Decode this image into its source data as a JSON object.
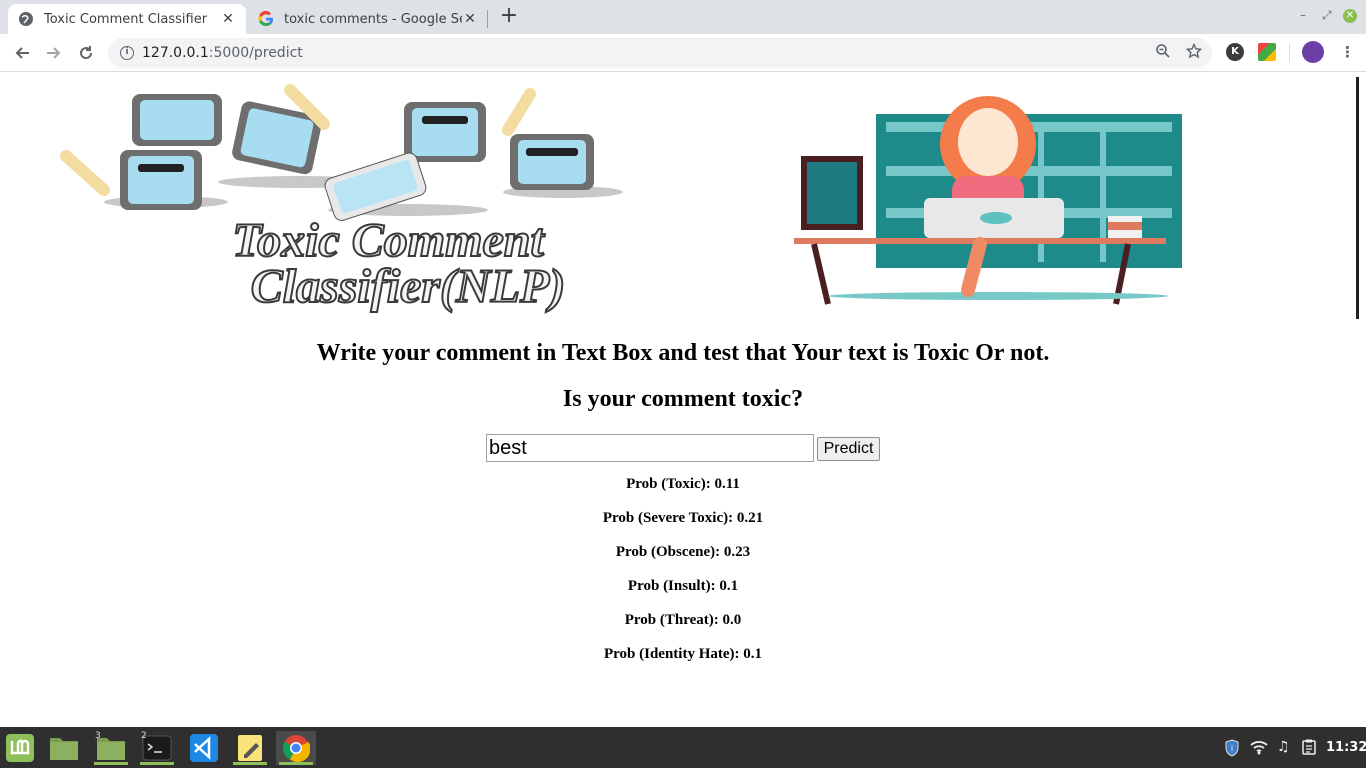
{
  "browser": {
    "tabs": [
      {
        "label": "Toxic Comment Classifier",
        "active": true
      },
      {
        "label": "toxic comments - Google Sear",
        "active": false
      }
    ],
    "url_host": "127.0.0.1",
    "url_path": ":5000/predict",
    "extensions": [
      {
        "label": "K",
        "color": "#c0392b"
      },
      {
        "label": "",
        "color": "#6c3fa6"
      }
    ]
  },
  "page": {
    "banner_title_line1": "Toxic Comment",
    "banner_title_line2": "Classifier(NLP)",
    "heading": "Write your comment in Text Box and test that Your text is Toxic Or not.",
    "subheading": "Is your comment toxic?",
    "input_value": "best",
    "predict_label": "Predict",
    "results": [
      "Prob (Toxic): 0.11",
      "Prob (Severe Toxic): 0.21",
      "Prob (Obscene): 0.23",
      "Prob (Insult): 0.1",
      "Prob (Threat): 0.0",
      "Prob (Identity Hate): 0.1"
    ]
  },
  "taskbar": {
    "badges": [
      "3",
      "2"
    ],
    "clock": "11:32"
  },
  "colors": {
    "accent_green": "#8fbf5a",
    "taskbar_bg": "#2f2f2f"
  }
}
